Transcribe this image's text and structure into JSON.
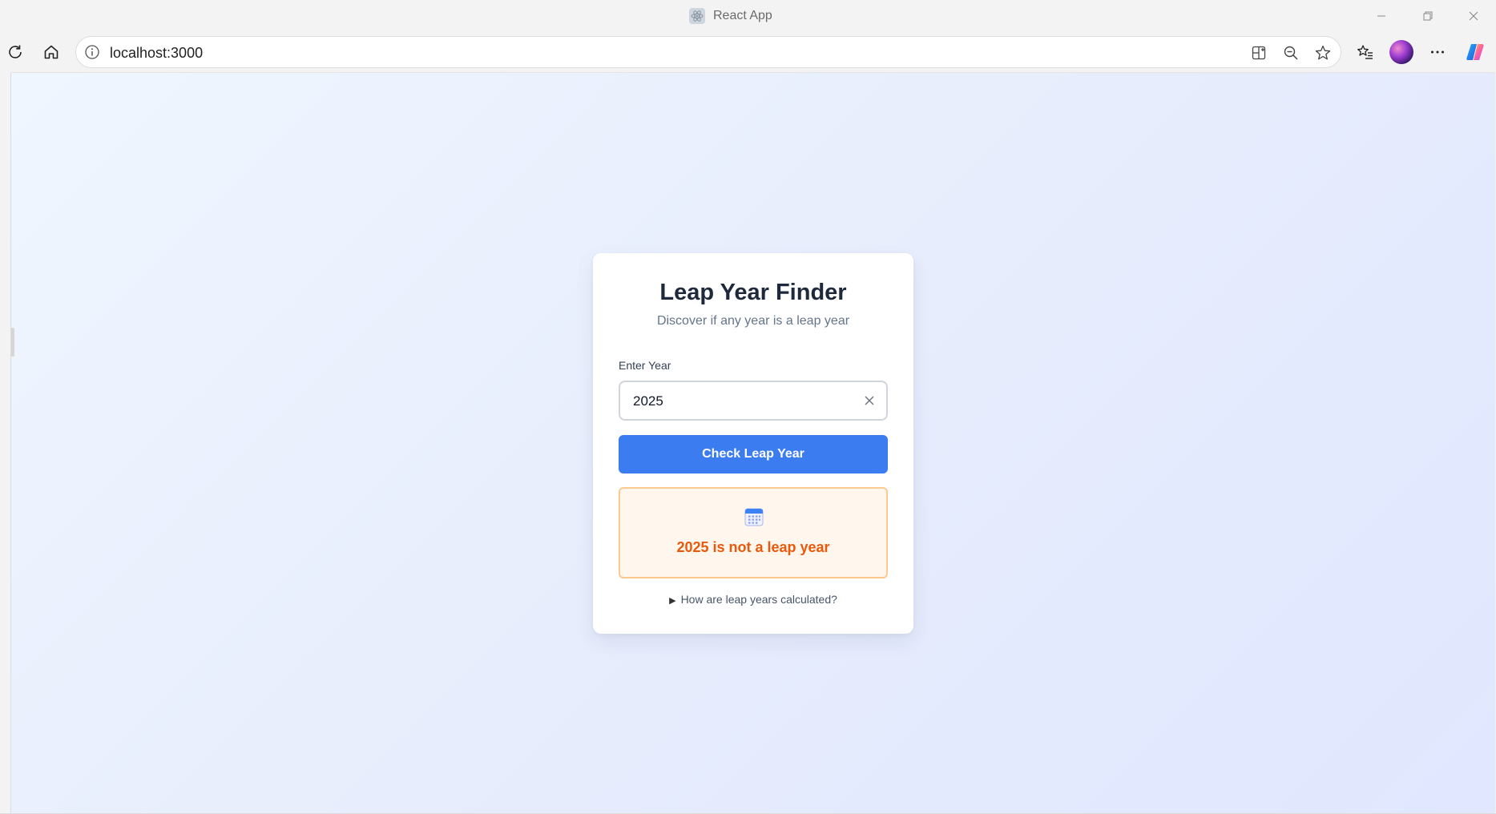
{
  "window": {
    "title": "React App",
    "icons": {
      "app": "react-atom-icon",
      "minimize": "minimize-icon",
      "restore": "restore-icon",
      "close": "close-icon"
    }
  },
  "toolbar": {
    "url": "localhost:3000",
    "icons": {
      "refresh": "refresh-icon",
      "home": "home-icon",
      "info": "info-icon",
      "app_grid": "app-grid-icon",
      "zoom_out": "zoom-out-icon",
      "favorite": "star-icon",
      "favorites_list": "favorites-icon",
      "more": "more-icon",
      "copilot": "copilot-icon"
    }
  },
  "app": {
    "title": "Leap Year Finder",
    "subtitle": "Discover if any year is a leap year",
    "input_label": "Enter Year",
    "input_value": "2025",
    "check_button_label": "Check Leap Year",
    "result_text": "2025 is not a leap year",
    "result_icon": "calendar-icon",
    "details_summary": "How are leap years calculated?",
    "colors": {
      "primary": "#3b7cf0",
      "result_text": "#ea580c",
      "result_bg": "#fff7ed",
      "result_border": "#fdc98e"
    }
  }
}
